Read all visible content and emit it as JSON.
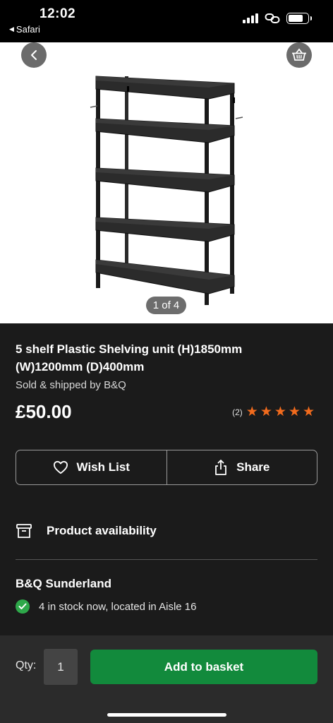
{
  "status_bar": {
    "time": "12:02",
    "back_app": "Safari",
    "icons": [
      "signal-icon",
      "link-icon",
      "battery-icon"
    ]
  },
  "gallery": {
    "page_indicator": "1 of 4",
    "back_icon": "chevron-left-icon",
    "basket_icon": "basket-icon"
  },
  "product": {
    "title": "5 shelf Plastic Shelving unit (H)1850mm (W)1200mm (D)400mm",
    "seller": "Sold & shipped by B&Q",
    "price": "£50.00",
    "rating_count": "(2)",
    "rating": 5,
    "rating_max": 5
  },
  "actions": {
    "wish_list": "Wish List",
    "share": "Share"
  },
  "availability": {
    "label": "Product availability",
    "store": "B&Q Sunderland",
    "stock": "4 in stock now, located in Aisle 16"
  },
  "bottom": {
    "qty_label": "Qty:",
    "qty_value": "1",
    "add_to_basket": "Add to basket"
  },
  "colors": {
    "background": "#1b1b1b",
    "star": "#f26b1d",
    "add_button": "#128a3c",
    "in_stock": "#2ea84a"
  }
}
